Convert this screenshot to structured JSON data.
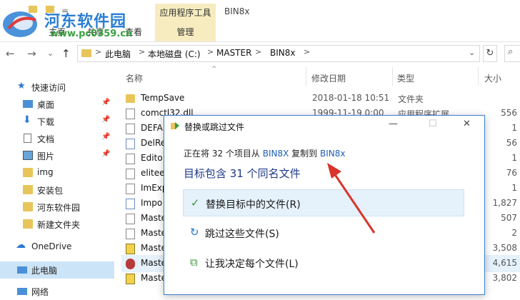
{
  "ribbon": {
    "quick_access_mark": "=",
    "context_group": "应用程序工具",
    "window_title": "BIN8x",
    "tabs": [
      "主页",
      "共享",
      "查看"
    ],
    "manage_tab": "管理"
  },
  "watermark": {
    "text": "河东软件园",
    "url": "www.pc0359.cn"
  },
  "address": {
    "crumbs": [
      "此电脑",
      "本地磁盘 (C:)",
      "MASTER",
      "BIN8x"
    ],
    "separator": ">",
    "dropdown": "⌄",
    "refresh": "↻"
  },
  "nav_buttons": {
    "back": "←",
    "forward": "→",
    "recent": "⌄",
    "up": "↑"
  },
  "nav": {
    "quick_access": "快速访问",
    "items": [
      "桌面",
      "下载",
      "文档",
      "图片",
      "img",
      "安装包",
      "河东软件园",
      "新建文件夹"
    ],
    "onedrive": "OneDrive",
    "thispc": "此电脑",
    "network": "网络"
  },
  "columns": {
    "name": "名称",
    "date": "修改日期",
    "type": "类型",
    "size": "大小",
    "sort_indicator": "^"
  },
  "files": [
    {
      "name": "TempSave",
      "date": "2018-01-18 10:51",
      "type": "文件夹",
      "size": ""
    },
    {
      "name": "comctl32.dll",
      "date": "1999-11-19 0:00",
      "type": "应用程序扩展",
      "size": "556"
    },
    {
      "name": "DEFA",
      "date": "",
      "type": "",
      "size": "1"
    },
    {
      "name": "DelRe",
      "date": "",
      "type": "",
      "size": "56"
    },
    {
      "name": "Edito",
      "date": "",
      "type": "",
      "size": "1"
    },
    {
      "name": "elitee",
      "date": "",
      "type": "",
      "size": "76"
    },
    {
      "name": "ImExp",
      "date": "",
      "type": "",
      "size": "1"
    },
    {
      "name": "Impo",
      "date": "",
      "type": "",
      "size": "1,827"
    },
    {
      "name": "Maste",
      "date": "",
      "type": "",
      "size": "507"
    },
    {
      "name": "Maste",
      "date": "",
      "type": "",
      "size": "2"
    },
    {
      "name": "Maste",
      "date": "",
      "type": "",
      "size": "3,508"
    },
    {
      "name": "Maste",
      "date": "",
      "type": "",
      "size": "4,615"
    },
    {
      "name": "Maste",
      "date": "",
      "type": "",
      "size": "3,802"
    }
  ],
  "dialog": {
    "title": "替换或跳过文件",
    "controls": {
      "minimize": "—",
      "maximize": "☐",
      "close": "✕"
    },
    "copy_prefix": "正在将 32 个项目从",
    "source": "BIN8X",
    "copy_middle": "复制到",
    "dest": "BIN8x",
    "heading": "目标包含 31 个同名文件",
    "options": [
      {
        "icon": "✓",
        "label": "替换目标中的文件(R)"
      },
      {
        "icon": "↻",
        "label": "跳过这些文件(S)"
      },
      {
        "icon": "⧉",
        "label": "让我决定每个文件(L)"
      }
    ]
  },
  "colors": {
    "accent": "#1e5fb4",
    "selection": "#e5f1fb",
    "folder": "#e8c55a",
    "arrow": "#d9342b",
    "context_tab": "#f6ecbf"
  }
}
